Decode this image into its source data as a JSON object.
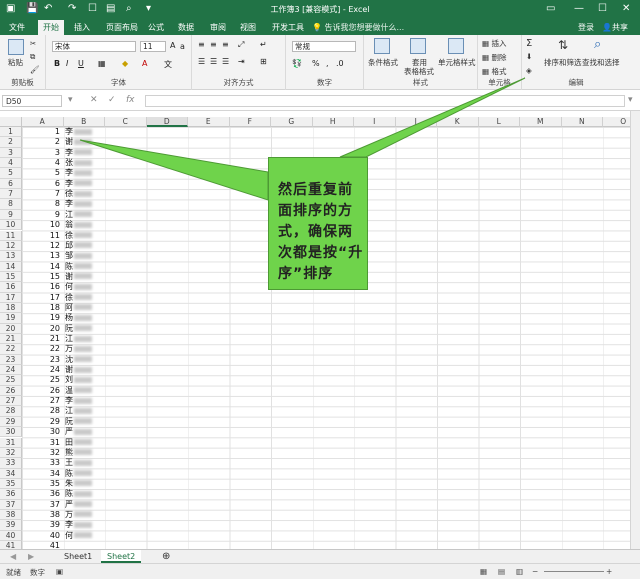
{
  "title": "工作簿3 [兼容模式] - Excel",
  "menu": [
    "文件",
    "开始",
    "插入",
    "页面布局",
    "公式",
    "数据",
    "审阅",
    "视图",
    "开发工具"
  ],
  "tell_me": "告诉我您想要做什么...",
  "login": "登录",
  "share": "共享",
  "ribbon": {
    "clipboard": {
      "label": "剪贴板",
      "paste": "粘贴"
    },
    "font": {
      "label": "字体",
      "name": "宋体",
      "size": "11"
    },
    "align": {
      "label": "对齐方式"
    },
    "number": {
      "label": "数字",
      "format": "常规"
    },
    "styles": {
      "label": "样式",
      "cond": "条件格式",
      "table1": "套用",
      "table2": "表格格式",
      "cell": "单元格样式"
    },
    "cells": {
      "label": "单元格",
      "insert": "插入",
      "delete": "删除",
      "format": "格式"
    },
    "edit": {
      "label": "编辑",
      "sort": "排序和筛选",
      "find": "查找和选择"
    }
  },
  "namebox": "D50",
  "columns": [
    "A",
    "B",
    "C",
    "D",
    "E",
    "F",
    "G",
    "H",
    "I",
    "J",
    "K",
    "L",
    "M",
    "N",
    "O"
  ],
  "rows": [
    "1",
    "2",
    "3",
    "4",
    "5",
    "6",
    "7",
    "8",
    "9",
    "10",
    "11",
    "12",
    "13",
    "14",
    "15",
    "16",
    "17",
    "18",
    "19",
    "20",
    "21",
    "22",
    "23",
    "24",
    "25",
    "26",
    "27",
    "28",
    "29",
    "30",
    "31",
    "32",
    "33",
    "34",
    "35",
    "36",
    "37",
    "38",
    "39",
    "40",
    "41"
  ],
  "col_a": [
    "1",
    "2",
    "3",
    "4",
    "5",
    "6",
    "7",
    "8",
    "9",
    "10",
    "11",
    "12",
    "13",
    "14",
    "15",
    "16",
    "17",
    "18",
    "19",
    "20",
    "21",
    "22",
    "23",
    "24",
    "25",
    "26",
    "27",
    "28",
    "29",
    "30",
    "31",
    "32",
    "33",
    "34",
    "35",
    "36",
    "37",
    "38",
    "39",
    "40",
    "41"
  ],
  "col_b": [
    "李",
    "谢",
    "李",
    "张",
    "李",
    "李",
    "徐",
    "李",
    "江",
    "翁",
    "徐",
    "邱",
    "邹",
    "陈",
    "谢",
    "何",
    "徐",
    "阿",
    "杨",
    "阮",
    "江",
    "万",
    "沈",
    "谢",
    "刘",
    "温",
    "李",
    "江",
    "阮",
    "严",
    "田",
    "熊",
    "王",
    "陈",
    "朱",
    "陈",
    "严",
    "万",
    "李",
    "何",
    ""
  ],
  "sheets": [
    "Sheet1",
    "Sheet2"
  ],
  "status": {
    "ready": "就绪",
    "numlock": "数字"
  },
  "callout": "然后重复前面排序的方式，确保两次都是按“升序”排序"
}
